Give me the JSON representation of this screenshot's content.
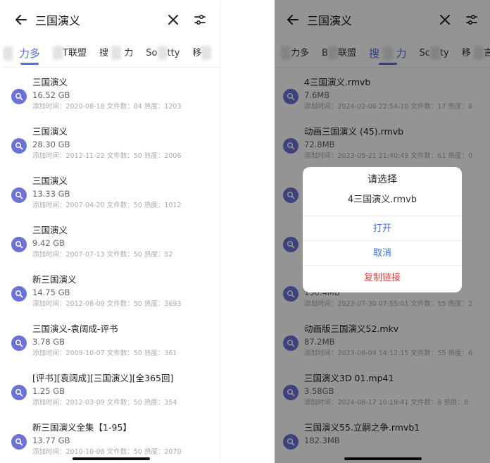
{
  "colors": {
    "accent": "#5b6be2",
    "danger": "#e23b3b",
    "avatar": "#6c73d6"
  },
  "left": {
    "query": "三国演义",
    "tabs": [
      "力多",
      "T联盟",
      "搜",
      "力",
      "So",
      "tty",
      "移"
    ],
    "results": [
      {
        "name": "三国演义",
        "size": "16.52 GB",
        "meta": "添加时间：2020-08-18  文件数：84  热度：1203"
      },
      {
        "name": "三国演义",
        "size": "28.30 GB",
        "meta": "添加时间：2012-11-22  文件数：50  热度：2006"
      },
      {
        "name": "三国演义",
        "size": "13.33 GB",
        "meta": "添加时间：2007-04-20  文件数：50  热度：1012"
      },
      {
        "name": "三国演义",
        "size": "9.42 GB",
        "meta": "添加时间：2007-07-13  文件数：50  热度：52"
      },
      {
        "name": "新三国演义",
        "size": "14.75 GB",
        "meta": "添加时间：2012-08-09  文件数：50  热度：3693"
      },
      {
        "name": "三国演义-袁阔成-评书",
        "size": "3.78 GB",
        "meta": "添加时间：2009-10-07  文件数：50  热度：361"
      },
      {
        "name": "[评书][袁阔成][三国演义][全365回]",
        "size": "1.25 GB",
        "meta": "添加时间：2012-03-09  文件数：50  热度：354"
      },
      {
        "name": "新三国演义全集【1-95】",
        "size": "13.77 GB",
        "meta": "添加时间：2010-10-08  文件数：50  热度：2070"
      }
    ]
  },
  "right": {
    "query": "三国演义",
    "tabs": [
      "力多",
      "B",
      "联盟",
      "搜",
      "力",
      "Sc",
      "ty",
      "移",
      "言"
    ],
    "results": [
      {
        "name": "4三国演义.rmvb",
        "size": "7.6MB",
        "meta": "添加时间：2024-02-06 22:54:10  文件数：17  热度：6"
      },
      {
        "name": "动画三国演义 (45).rmvb",
        "size": "72.8MB",
        "meta": "添加时间：2023-05-21 21:40:49  文件数：61  热度：0"
      },
      {
        "name": "",
        "size": "",
        "meta": ""
      },
      {
        "name": "",
        "size": "",
        "meta": ""
      },
      {
        "name": "",
        "size": "150.4MB",
        "meta": "添加时间：2023-07-30 07:55:01  文件数：55  热度：2"
      },
      {
        "name": "动画版三国演义52.mkv",
        "size": "87.2MB",
        "meta": "添加时间：2023-08-04 14:12:15  文件数：55  热度：6"
      },
      {
        "name": "三国演义3D 01.mp41",
        "size": "3.58GB",
        "meta": "添加时间：2024-08-17 10:19:41  文件数：8  热度：8"
      },
      {
        "name": "三国演义55.立嗣之争.rmvb1",
        "size": "182.3MB",
        "meta": ""
      }
    ],
    "dialog": {
      "title": "请选择",
      "message": "4三国演义.rmvb",
      "open": "打开",
      "cancel": "取消",
      "copy": "复制链接"
    }
  }
}
